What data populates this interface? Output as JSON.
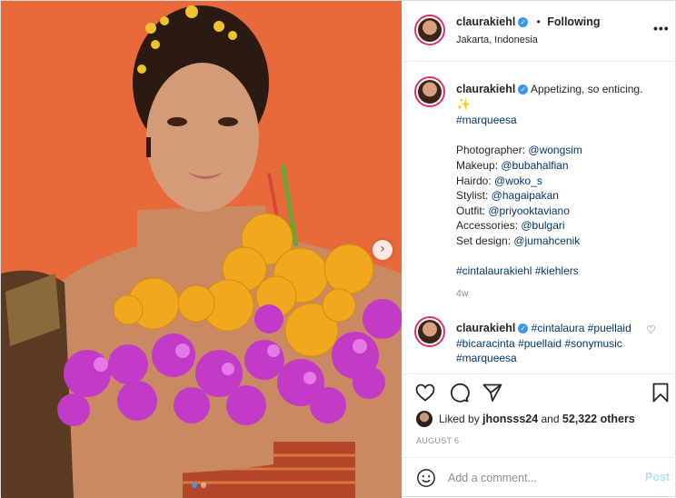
{
  "header": {
    "username": "claurakiehl",
    "separator": "•",
    "follow_status": "Following",
    "location": "Jakarta, Indonesia",
    "more_icon": "more-horizontal-icon"
  },
  "caption": {
    "username": "claurakiehl",
    "text": "Appetizing, so enticing.",
    "sparkle_icon": "✨",
    "hashtag_top": "#marqueesa",
    "credits": [
      {
        "label": "Photographer: ",
        "handle": "@wongsim"
      },
      {
        "label": "Makeup: ",
        "handle": "@bubahalfian"
      },
      {
        "label": "Hairdo: ",
        "handle": "@woko_s"
      },
      {
        "label": "Stylist: ",
        "handle": "@hagaipakan"
      },
      {
        "label": "Outfit: ",
        "handle": "@priyooktaviano"
      },
      {
        "label": "Accessories: ",
        "handle": "@bulgari"
      },
      {
        "label": "Set design: ",
        "handle": "@jumahcenik"
      }
    ],
    "hashtag_bottom_1": "#cintalaurakiehl",
    "hashtag_bottom_2": "#kiehlers",
    "age": "4w"
  },
  "comment": {
    "username": "claurakiehl",
    "tags": [
      "#cintalaura",
      "#puellaid",
      "#bicaracinta",
      "#puellaid",
      "#sonymusic",
      "#marqueesa"
    ]
  },
  "likes": {
    "prefix": "Liked by ",
    "user": "jhonsss24",
    "middle": " and ",
    "count": "52,322 others"
  },
  "date": "AUGUST 6",
  "add_comment": {
    "placeholder": "Add a comment...",
    "post_label": "Post"
  },
  "carousel": {
    "next_icon": "›",
    "slide_count": 2,
    "current_slide": 1
  },
  "colors": {
    "background_orange": "#e86a38",
    "link_blue": "#00376b",
    "accent_blue": "#3897f0",
    "post_disabled": "#b2dffc"
  }
}
